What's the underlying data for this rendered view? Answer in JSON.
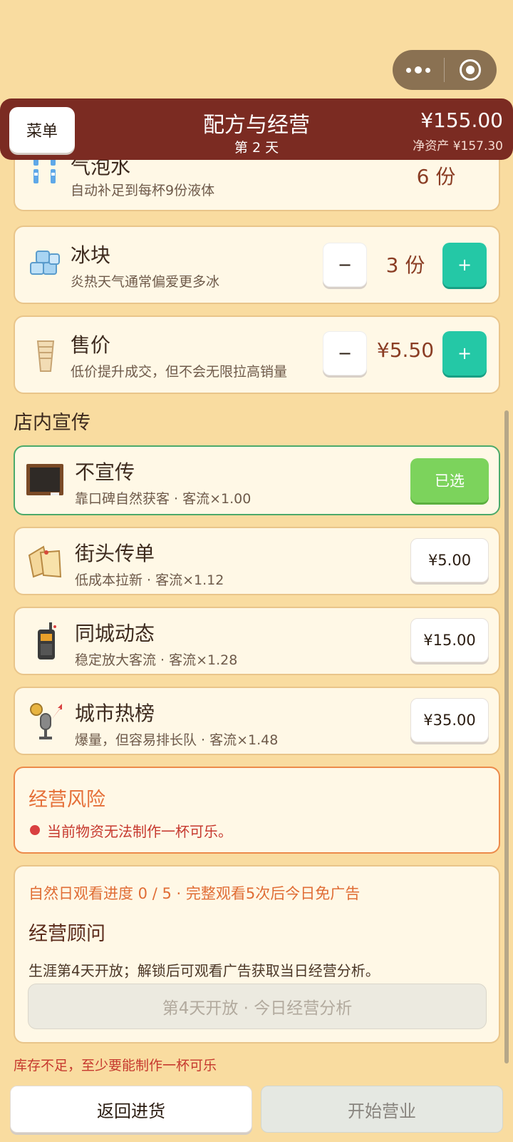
{
  "header": {
    "menu_label": "菜单",
    "title": "配方与经营",
    "day": "第 2 天",
    "money": "¥155.00",
    "net_worth": "净资产 ¥157.30"
  },
  "recipe": {
    "soda": {
      "name": "气泡水",
      "desc": "自动补足到每杯9份液体",
      "qty": "6 份",
      "icon": "soda-bottles-icon"
    },
    "ice": {
      "name": "冰块",
      "desc": "炎热天气通常偏爱更多冰",
      "qty": "3 份",
      "minus": "−",
      "plus": "+",
      "icon": "ice-cubes-icon"
    },
    "price": {
      "name": "售价",
      "desc": "低价提升成交，但不会无限拉高销量",
      "qty": "¥5.50",
      "minus": "−",
      "plus": "+",
      "icon": "paper-cups-icon"
    }
  },
  "promotion": {
    "section_title": "店内宣传",
    "items": [
      {
        "name": "不宣传",
        "desc": "靠口碑自然获客 · 客流×1.00",
        "action": "已选",
        "selected": true,
        "icon": "blackboard-icon"
      },
      {
        "name": "街头传单",
        "desc": "低成本拉新 · 客流×1.12",
        "action": "¥5.00",
        "selected": false,
        "icon": "flyers-icon"
      },
      {
        "name": "同城动态",
        "desc": "稳定放大客流 · 客流×1.28",
        "action": "¥15.00",
        "selected": false,
        "icon": "walkie-talkie-icon"
      },
      {
        "name": "城市热榜",
        "desc": "爆量，但容易排长队 · 客流×1.48",
        "action": "¥35.00",
        "selected": false,
        "icon": "trophy-microphone-icon"
      }
    ]
  },
  "risk": {
    "title": "经营风险",
    "message": "当前物资无法制作一杯可乐。"
  },
  "advisor": {
    "progress": "自然日观看进度 0 / 5 · 完整观看5次后今日免广告",
    "title": "经营顾问",
    "desc": "生涯第4天开放；解锁后可观看广告获取当日经营分析。",
    "button": "第4天开放 · 今日经营分析"
  },
  "warning": "库存不足，至少要能制作一杯可乐",
  "bottom": {
    "back": "返回进货",
    "start": "开始营业"
  },
  "colors": {
    "header": "#7b2b22",
    "background": "#f9dca0",
    "accent_plus": "#24c8a6",
    "selected": "#7cd35c",
    "risk": "#e56f38"
  }
}
